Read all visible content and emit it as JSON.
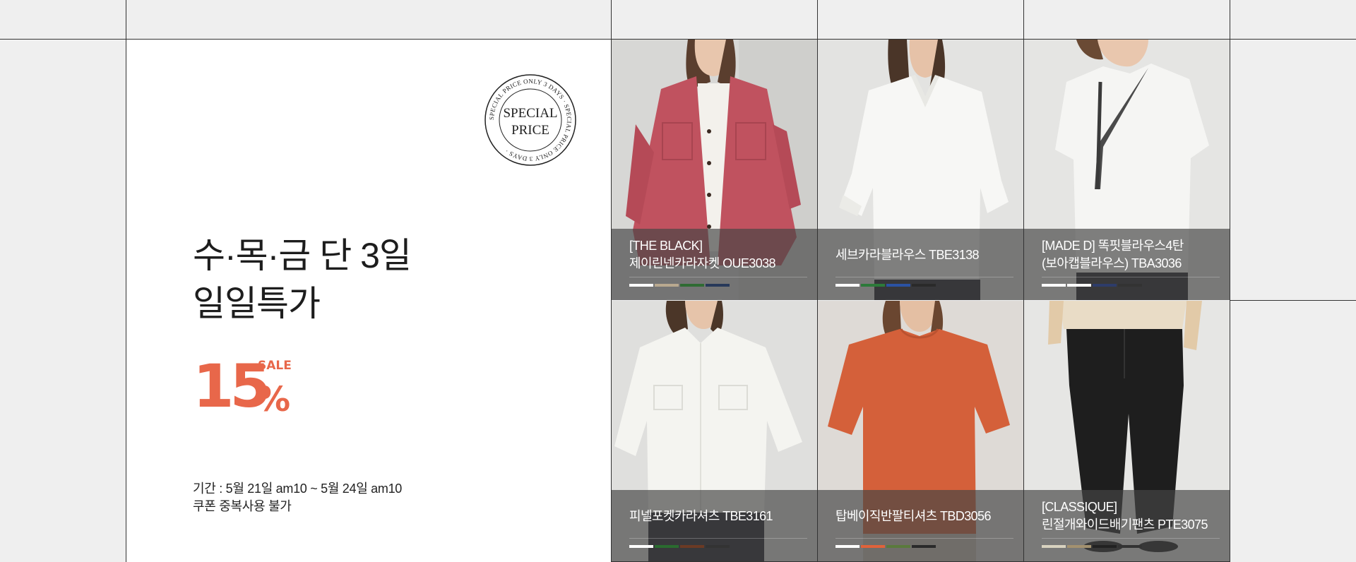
{
  "promo": {
    "stamp_line1": "SPECIAL",
    "stamp_line2": "PRICE",
    "stamp_ring": "SPECIAL PRICE ONLY 3 DAYS · SPECIAL PRICE ONLY 3 DAYS ·",
    "headline_line1": "수·목·금 단 3일",
    "headline_line2": "일일특가",
    "discount_number": "15",
    "discount_percent": "%",
    "discount_tag": "SALE",
    "period_line1": "기간 : 5월 21일 am10 ~ 5월 24일 am10",
    "period_line2": "쿠폰 중복사용 불가",
    "accent_color": "#e8674a"
  },
  "products": [
    {
      "line1": "[THE BLACK]",
      "line2": "제이린넨카라자켓 OUE3038",
      "garment_color": "#c0525f",
      "swatches": [
        "#ffffff",
        "#b9a98f",
        "#2f6b33",
        "#27395a"
      ]
    },
    {
      "line1": "",
      "line2": "세브카라블라우스 TBE3138",
      "garment_color": "#f7f7f5",
      "swatches": [
        "#ffffff",
        "#2c7a3a",
        "#2b52a3",
        "#2a2a2a"
      ]
    },
    {
      "line1": "[MADE D] 똑핏블라우스4탄",
      "line2": "(보아캡블라우스) TBA3036",
      "garment_color": "#f5f5f3",
      "swatches": [
        "#ffffff",
        "#ffffff",
        "#2d3c6a",
        "#333333"
      ]
    },
    {
      "line1": "",
      "line2": "피넬포켓카라셔츠 TBE3161",
      "garment_color": "#f4f4f0",
      "swatches": [
        "#ffffff",
        "#2a6b2f",
        "#6b3a24",
        "#333333"
      ]
    },
    {
      "line1": "",
      "line2": "탑베이직반팔티셔츠 TBD3056",
      "garment_color": "#d4603a",
      "swatches": [
        "#ffffff",
        "#e0623a",
        "#5a7a3c",
        "#2a2a2a"
      ]
    },
    {
      "line1": "[CLASSIQUE]",
      "line2": "린절개와이드배기팬츠 PTE3075",
      "garment_color": "#1e1e1e",
      "swatches": [
        "#d8d2bf",
        "#a3916f",
        "#222222",
        "#333333"
      ]
    }
  ]
}
